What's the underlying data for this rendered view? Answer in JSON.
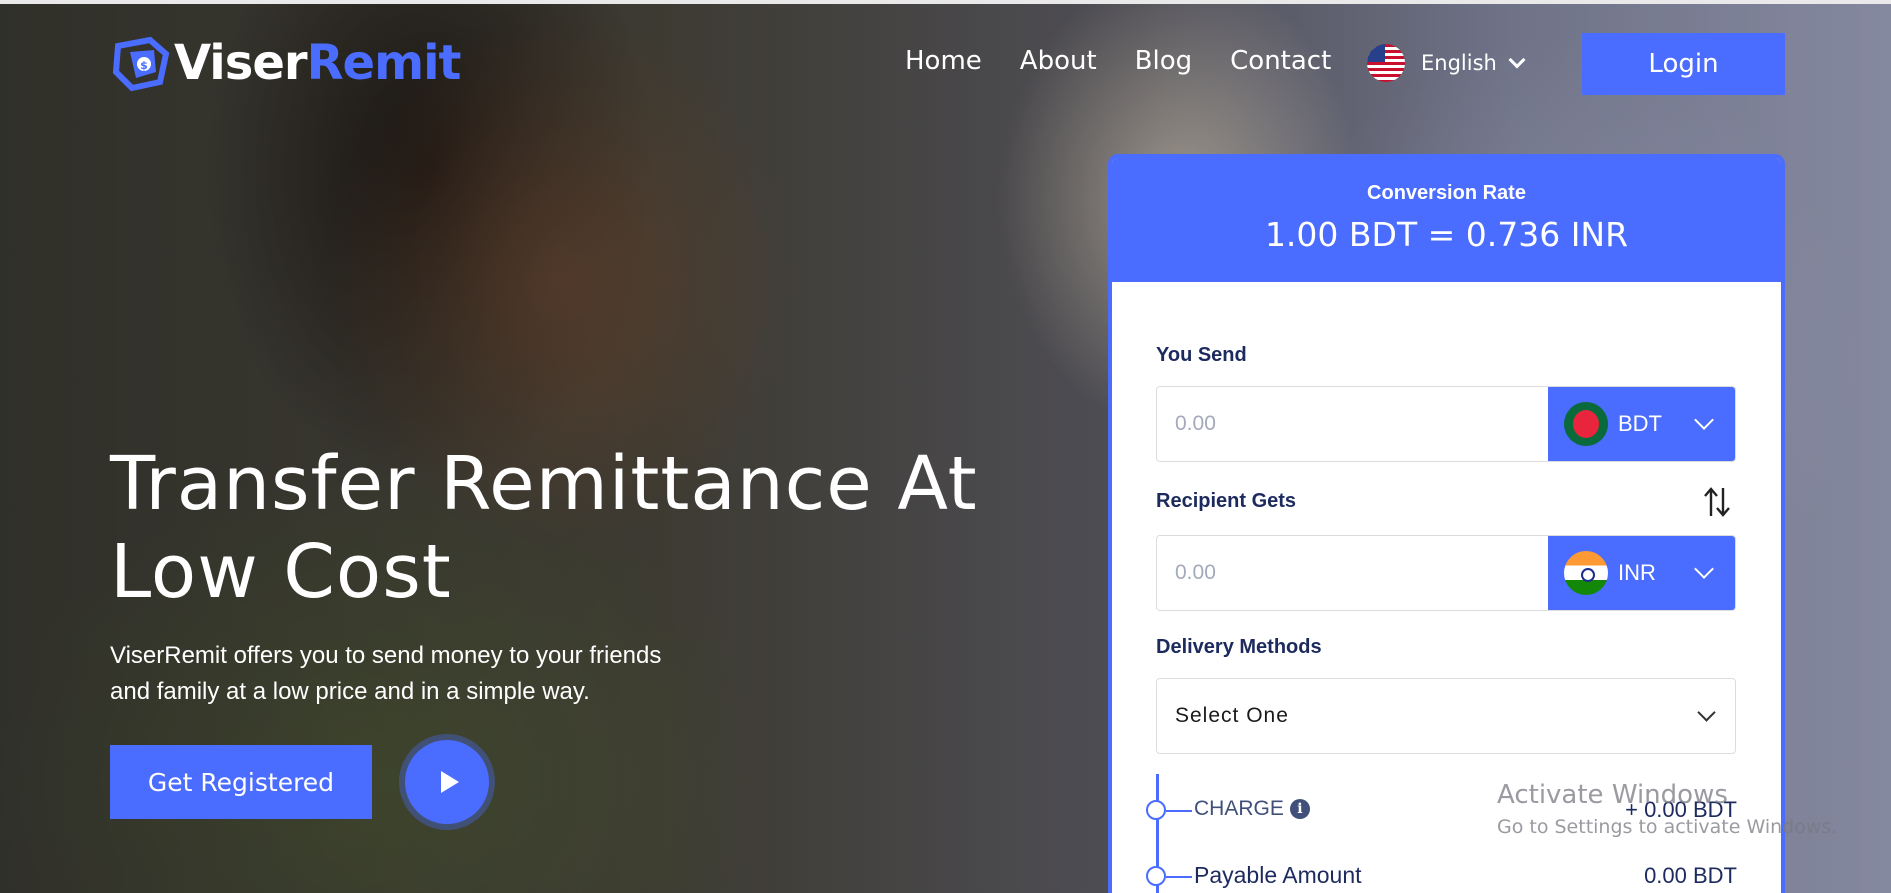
{
  "brand": {
    "name_part1": "Viser",
    "name_part2": "Remit",
    "primary_color": "#4a6cff"
  },
  "nav": {
    "items": [
      {
        "label": "Home"
      },
      {
        "label": "About"
      },
      {
        "label": "Blog"
      },
      {
        "label": "Contact"
      }
    ],
    "language": {
      "label": "English",
      "icon": "us-flag-icon"
    },
    "login_label": "Login"
  },
  "hero": {
    "title_line1": "Transfer Remittance At",
    "title_line2": "Low Cost",
    "description_line1": "ViserRemit offers you to send money to your friends",
    "description_line2": "and family at a low price and in a simple way.",
    "register_label": "Get Registered"
  },
  "converter": {
    "conversion_label": "Conversion Rate",
    "conversion_rate": "1.00 BDT = 0.736 INR",
    "send": {
      "label": "You Send",
      "placeholder": "0.00",
      "currency": "BDT",
      "flag_icon": "bangladesh-flag-icon"
    },
    "receive": {
      "label": "Recipient Gets",
      "placeholder": "0.00",
      "currency": "INR",
      "flag_icon": "india-flag-icon"
    },
    "delivery": {
      "label": "Delivery Methods",
      "selected": "Select One"
    },
    "charge": {
      "label": "CHARGE",
      "value": "+ 0.00 BDT"
    },
    "payable": {
      "label": "Payable Amount",
      "value": "0.00 BDT"
    }
  },
  "watermark": {
    "line1": "Activate Windows",
    "line2": "Go to Settings to activate Windows."
  }
}
